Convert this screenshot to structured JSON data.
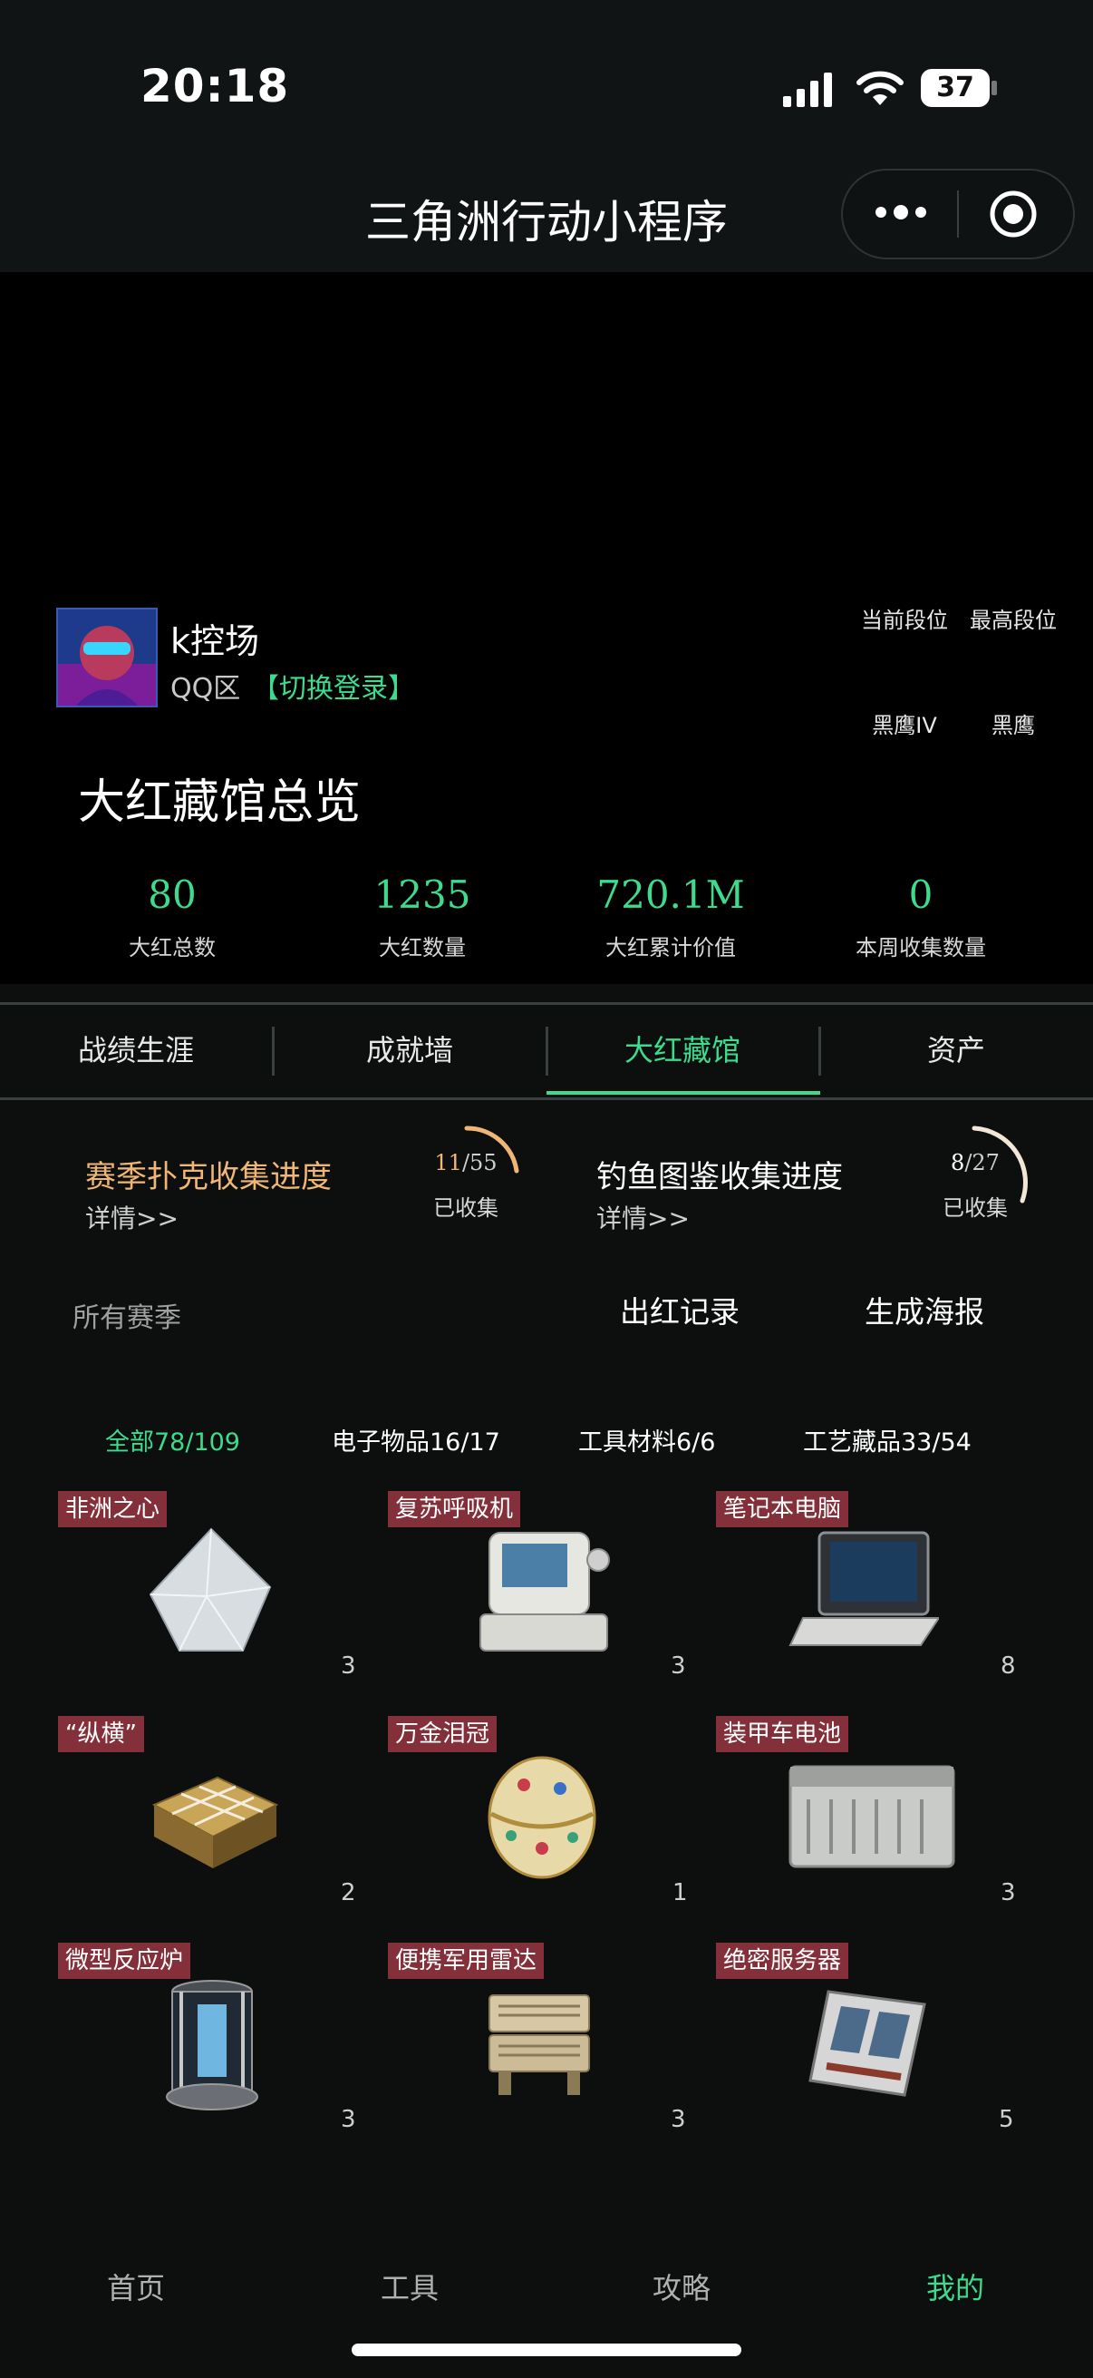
{
  "status": {
    "time": "20:18",
    "battery": "37"
  },
  "nav": {
    "title": "三角洲行动小程序"
  },
  "profile": {
    "nickname": "k控场",
    "region": "QQ区",
    "switch_login": "【切换登录】",
    "current_rank_label": "当前段位",
    "max_rank_label": "最高段位",
    "current_rank": "黑鹰IV",
    "max_rank": "黑鹰"
  },
  "overview": {
    "title": "大红藏馆总览",
    "stats": [
      {
        "value": "80",
        "label": "大红总数"
      },
      {
        "value": "1235",
        "label": "大红数量"
      },
      {
        "value": "720.1M",
        "label": "大红累计价值"
      },
      {
        "value": "0",
        "label": "本周收集数量"
      }
    ]
  },
  "tabs": [
    {
      "label": "战绩生涯"
    },
    {
      "label": "成就墙"
    },
    {
      "label": "大红藏馆"
    },
    {
      "label": "资产"
    }
  ],
  "progress": [
    {
      "title": "赛季扑克收集进度",
      "detail": "详情>>",
      "done": "11",
      "total": "/55",
      "collected": "已收集",
      "color": "#f0b675"
    },
    {
      "title": "钓鱼图鉴收集进度",
      "detail": "详情>>",
      "done": "8",
      "total": "/27",
      "collected": "已收集",
      "color": "#ffffff"
    }
  ],
  "season_select": "所有赛季",
  "actions": {
    "red_records": "出红记录",
    "make_poster": "生成海报"
  },
  "filters": [
    {
      "label": "全部78/109"
    },
    {
      "label": "电子物品16/17"
    },
    {
      "label": "工具材料6/6"
    },
    {
      "label": "工艺藏品33/54"
    }
  ],
  "items": [
    {
      "name": "非洲之心",
      "count": "3",
      "icon": "diamond-icon"
    },
    {
      "name": "复苏呼吸机",
      "count": "3",
      "icon": "ventilator-icon"
    },
    {
      "name": "笔记本电脑",
      "count": "8",
      "icon": "laptop-icon"
    },
    {
      "name": "“纵横”",
      "count": "2",
      "icon": "chessboard-icon"
    },
    {
      "name": "万金泪冠",
      "count": "1",
      "icon": "jewel-egg-icon"
    },
    {
      "name": "装甲车电池",
      "count": "3",
      "icon": "battery-icon"
    },
    {
      "name": "微型反应炉",
      "count": "3",
      "icon": "reactor-icon"
    },
    {
      "name": "便携军用雷达",
      "count": "3",
      "icon": "radar-icon"
    },
    {
      "name": "绝密服务器",
      "count": "5",
      "icon": "server-icon"
    }
  ],
  "bottom_nav": [
    {
      "label": "首页"
    },
    {
      "label": "工具"
    },
    {
      "label": "攻略"
    },
    {
      "label": "我的"
    }
  ],
  "colors": {
    "accent": "#3ddb8d",
    "label_bg": "#84303a",
    "poker": "#f0b675"
  }
}
